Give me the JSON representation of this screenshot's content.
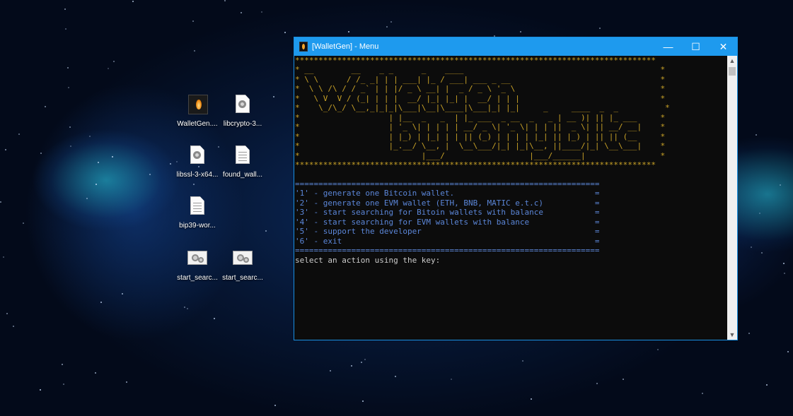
{
  "desktop": {
    "icons": [
      {
        "label": "WalletGen....",
        "icon": "walletgen-exe-icon"
      },
      {
        "label": "libcrypto-3...",
        "icon": "dll-file-icon"
      },
      {
        "label": "libssl-3-x64...",
        "icon": "dll-file-icon"
      },
      {
        "label": "found_wall...",
        "icon": "text-file-icon"
      },
      {
        "label": "bip39-wor...",
        "icon": "text-file-icon"
      },
      {
        "label": "start_searc...",
        "icon": "batch-file-icon"
      },
      {
        "label": "start_searc...",
        "icon": "batch-file-icon"
      }
    ]
  },
  "window": {
    "title": "[WalletGen] - Menu",
    "minimize": "—",
    "maximize": "☐",
    "close": "✕"
  },
  "console": {
    "banner": [
      "*****************************************************************************",
      "* __        __    _ _      _    ____                                          *",
      "* \\ \\      / /_ _| | | ___| |_ / ___| ___ _ __                                *",
      "*  \\ \\ /\\ / / _` | | |/ _ \\ __| |  _ / _ \\ '_ \\                               *",
      "*   \\ V  V / (_| | | |  __/ |_| |_| |  __/ | | |                              *",
      "*    \\_/\\_/ \\__,_|_|_|\\___|\\__|\\____|\\___|_| |_|     _     ____  _  _          *",
      "*                   | |__  _   _  | |_ ___  _ __  _   _ | __ )| || |_ ___     *",
      "*                   | '_ \\| | | | | __/ _ \\| '_ \\| | | ||  _ \\| || __/ __|    *",
      "*                   | |_) | |_| | | || (_) | | | | |_| || |_) | || || (__     *",
      "*                   |_.__/ \\__, |  \\__\\___/|_| |_|\\__, ||____/|_| \\__\\___|    *",
      "*                          |___/                  |___/______|                *",
      "*****************************************************************************"
    ],
    "separator": "=================================================================",
    "menu": [
      {
        "text": "'1' - generate one Bitcoin wallet.",
        "end": "="
      },
      {
        "text": "'2' - generate one EVM wallet (ETH, BNB, MATIC e.t.c)",
        "end": "="
      },
      {
        "text": "'3' - start searching for Bitoin wallets with balance",
        "end": "="
      },
      {
        "text": "'4' - start searching for EVM wallets with balance",
        "end": "="
      },
      {
        "text": "'5' - support the developer",
        "end": "="
      },
      {
        "text": "'6' - exit",
        "end": "="
      }
    ],
    "prompt": "select an action using the key:"
  }
}
